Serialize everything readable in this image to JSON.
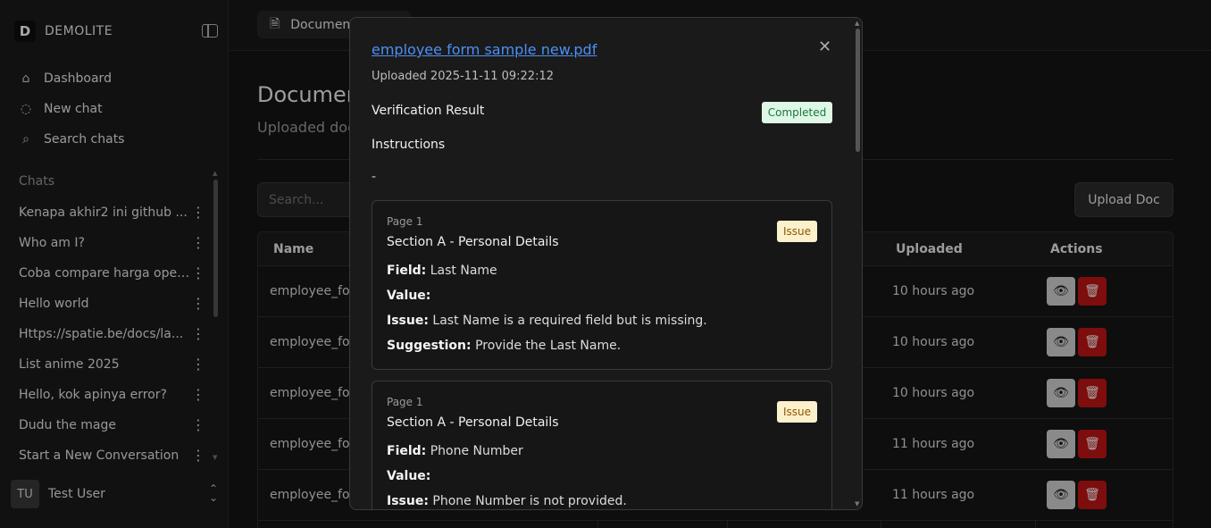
{
  "sidebar": {
    "brand_letter": "D",
    "brand_name": "DEMOLITE",
    "nav": [
      {
        "label": "Dashboard",
        "icon": "home-icon"
      },
      {
        "label": "New chat",
        "icon": "chat-icon"
      },
      {
        "label": "Search chats",
        "icon": "search-icon"
      }
    ],
    "chats_label": "Chats",
    "chats": [
      "Kenapa akhir2 ini github ...",
      "Who am I?",
      "Coba compare harga open a...",
      "Hello world",
      "Https://spatie.be/docs/la...",
      "List anime 2025",
      "Hello, kok apinya error?",
      "Dudu the mage",
      "Start a New Conversation"
    ],
    "user": {
      "initials": "TU",
      "name": "Test User"
    }
  },
  "main": {
    "tab_label": "Documen",
    "title": "Documen",
    "subtitle": "Uploaded doc",
    "search_placeholder": "Search...",
    "upload_button": "Upload Doc",
    "columns": {
      "name": "Name",
      "uploaded": "Uploaded",
      "actions": "Actions"
    },
    "rows": [
      {
        "name": "employee_form",
        "uploaded": "10 hours ago"
      },
      {
        "name": "employee_form",
        "uploaded": "10 hours ago"
      },
      {
        "name": "employee_form",
        "uploaded": "10 hours ago"
      },
      {
        "name": "employee_form",
        "uploaded": "11 hours ago"
      },
      {
        "name": "employee_form",
        "uploaded": "11 hours ago"
      }
    ]
  },
  "modal": {
    "file_name": "employee form sample new.pdf",
    "uploaded": "Uploaded 2025-11-11 09:22:12",
    "verification_label": "Verification Result",
    "status": "Completed",
    "instructions_label": "Instructions",
    "instructions_value": "-",
    "cards": [
      {
        "page": "Page 1",
        "section": "Section A - Personal Details",
        "badge": "Issue",
        "field_label": "Field:",
        "field": "Last Name",
        "value_label": "Value:",
        "value": "",
        "issue_label": "Issue:",
        "issue": "Last Name is a required field but is missing.",
        "suggestion_label": "Suggestion:",
        "suggestion": "Provide the Last Name."
      },
      {
        "page": "Page 1",
        "section": "Section A - Personal Details",
        "badge": "Issue",
        "field_label": "Field:",
        "field": "Phone Number",
        "value_label": "Value:",
        "value": "",
        "issue_label": "Issue:",
        "issue": "Phone Number is not provided."
      }
    ]
  },
  "colors": {
    "link": "#4d8ff7",
    "delete": "#c21414",
    "success_bg": "#dff7e6",
    "warning_bg": "#fdf0cc"
  }
}
